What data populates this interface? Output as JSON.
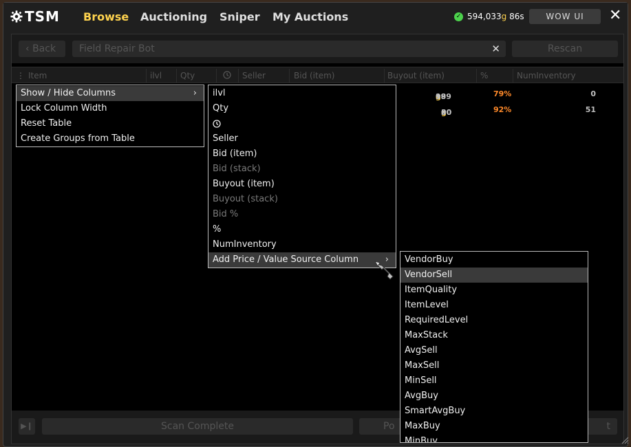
{
  "app": {
    "logo": "TSM",
    "nav": [
      "Browse",
      "Auctioning",
      "Sniper",
      "My Auctions"
    ],
    "gold_amount": "594,033",
    "gold_unit": "g",
    "gold_silver": "86s",
    "wow_ui_label": "WOW UI",
    "close_glyph": "✕"
  },
  "toolbar": {
    "back_label": "Back",
    "search_value": "Field Repair Bot",
    "clear_glyph": "✕",
    "rescan_label": "Rescan"
  },
  "table": {
    "headers": [
      "Item",
      "ilvl",
      "Qty",
      "Seller",
      "Bid (item)",
      "Buyout (item)",
      "%",
      "NumInventory"
    ],
    "rows": [
      {
        "buyout_gold": "189",
        "buyout_silver": "99",
        "pct": "79%",
        "inventory": "0"
      },
      {
        "buyout_gold": "30",
        "buyout_silver": "00",
        "pct": "92%",
        "inventory": "51"
      }
    ]
  },
  "bottom": {
    "scan_status": "Scan Complete",
    "post_label": "Po",
    "right_label": "t"
  },
  "context_menu": {
    "items": [
      "Show / Hide Columns",
      "Lock Column Width",
      "Reset Table",
      "Create Groups from Table"
    ],
    "arrow": "›"
  },
  "columns_menu": {
    "items": [
      {
        "label": "ilvl",
        "enabled": true
      },
      {
        "label": "Qty",
        "enabled": true
      },
      {
        "label": "",
        "enabled": true
      },
      {
        "label": "Seller",
        "enabled": true
      },
      {
        "label": "Bid (item)",
        "enabled": true
      },
      {
        "label": "Bid (stack)",
        "enabled": false
      },
      {
        "label": "Buyout (item)",
        "enabled": true
      },
      {
        "label": "Buyout (stack)",
        "enabled": false
      },
      {
        "label": "Bid %",
        "enabled": false
      },
      {
        "label": "%",
        "enabled": true
      },
      {
        "label": "NumInventory",
        "enabled": true
      },
      {
        "label": "Add Price / Value Source Column",
        "enabled": true
      }
    ]
  },
  "source_menu": {
    "items": [
      "VendorBuy",
      "VendorSell",
      "ItemQuality",
      "ItemLevel",
      "RequiredLevel",
      "MaxStack",
      "AvgSell",
      "MaxSell",
      "MinSell",
      "AvgBuy",
      "SmartAvgBuy",
      "MaxBuy",
      "MinBuy"
    ],
    "highlighted": "VendorSell"
  },
  "colors": {
    "accent": "#ffd34e",
    "gold": "#ffd34e",
    "silver": "#c0c0c0",
    "pct_color": "#ff8a2a",
    "online": "#4cd14c"
  }
}
